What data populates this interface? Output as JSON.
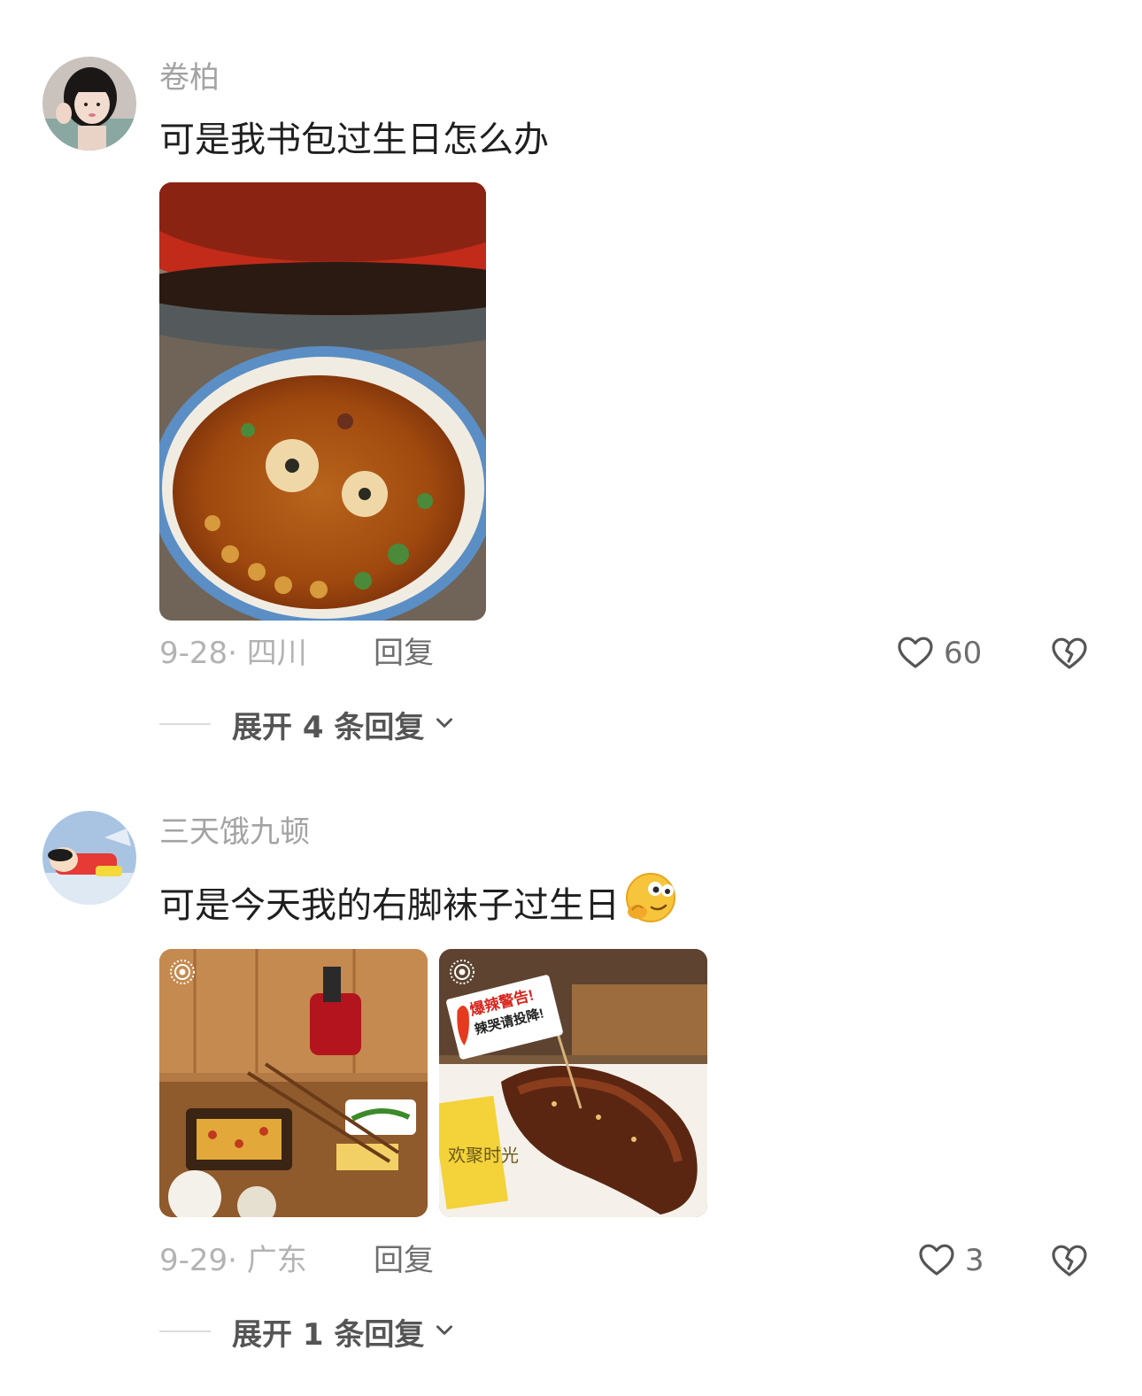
{
  "comments": [
    {
      "username": "卷柏",
      "text": "可是我书包过生日怎么办",
      "date_location": "9-28· 四川",
      "reply_label": "回复",
      "like_count": "60",
      "expand_label": "展开 4 条回复"
    },
    {
      "username": "三天饿九顿",
      "text": "可是今天我的右脚袜子过生日",
      "date_location": "9-29· 广东",
      "reply_label": "回复",
      "like_count": "3",
      "expand_label": "展开 1 条回复",
      "emoji": "thinking-face-emoji"
    }
  ],
  "photo_texts": {
    "flag_line1": "爆辣警告!",
    "flag_line2": "辣哭请投降!",
    "card_text": "欢聚时光"
  },
  "colors": {
    "username": "#a3a3a3",
    "text": "#1f1f1f",
    "meta": "#b3b3b3",
    "action": "#6e6e6e"
  }
}
